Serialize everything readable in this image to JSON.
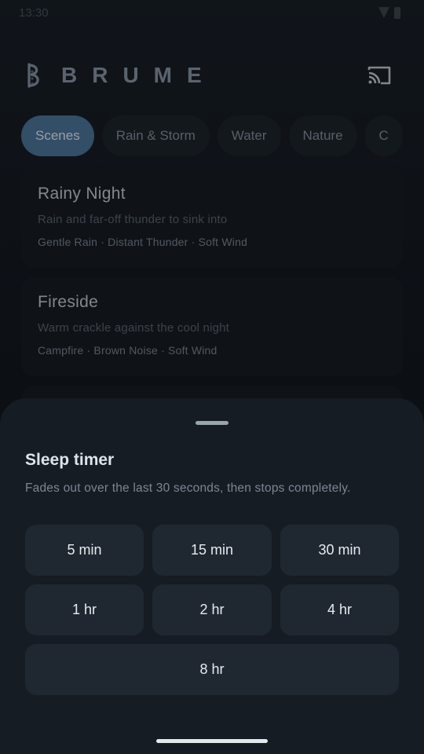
{
  "status": {
    "time": "13:30"
  },
  "app": {
    "name": "BRUME",
    "logo_icon": "brume-logo-icon",
    "cast_icon": "cast-icon"
  },
  "chips": [
    {
      "label": "Scenes",
      "active": true
    },
    {
      "label": "Rain & Storm",
      "active": false
    },
    {
      "label": "Water",
      "active": false
    },
    {
      "label": "Nature",
      "active": false
    },
    {
      "label": "C",
      "active": false
    }
  ],
  "scenes": [
    {
      "title": "Rainy Night",
      "description": "Rain and far-off thunder to sink into",
      "tags": "Gentle Rain · Distant Thunder · Soft Wind"
    },
    {
      "title": "Fireside",
      "description": "Warm crackle against the cool night",
      "tags": "Campfire · Brown Noise · Soft Wind"
    }
  ],
  "sleep_timer": {
    "title": "Sleep timer",
    "subtitle": "Fades out over the last 30 seconds, then stops completely.",
    "options": [
      "5 min",
      "15 min",
      "30 min",
      "1 hr",
      "2 hr",
      "4 hr",
      "8 hr"
    ]
  },
  "colors": {
    "accent": "#4f789e",
    "sheet": "#151c24",
    "button": "#1f2730"
  }
}
